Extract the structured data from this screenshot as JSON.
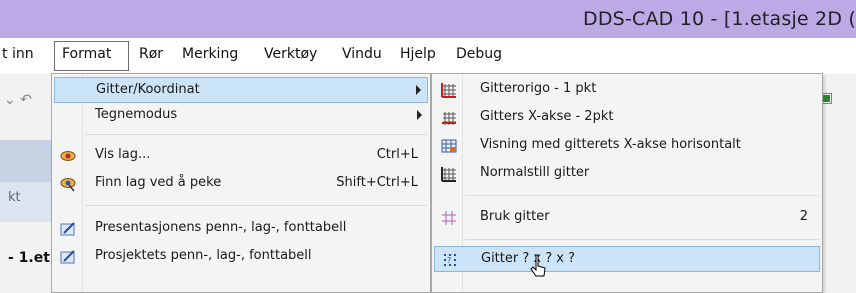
{
  "window": {
    "title": "DDS-CAD 10 - [1.etasje 2D ("
  },
  "menubar": {
    "items": [
      "t inn",
      "Format",
      "Rør",
      "Merking",
      "Verktøy",
      "Vindu",
      "Hjelp",
      "Debug"
    ],
    "active": "Format"
  },
  "background": {
    "tree_label_1": "kt",
    "tree_label_2": "- 1.et"
  },
  "format_menu": {
    "items": [
      {
        "label": "Gitter/Koordinat",
        "shortcut": "",
        "submenu": true,
        "highlighted": true,
        "icon": "none"
      },
      {
        "label": "Tegnemodus",
        "shortcut": "",
        "submenu": true,
        "icon": "none"
      },
      {
        "label": "Vis lag...",
        "shortcut": "Ctrl+L",
        "icon": "eye-icon"
      },
      {
        "label": "Finn lag ved å peke",
        "shortcut": "Shift+Ctrl+L",
        "icon": "eye-pointer-icon"
      },
      {
        "label": "Presentasjonens penn-, lag-, fonttabell",
        "shortcut": "",
        "icon": "pen-table-icon"
      },
      {
        "label": "Prosjektets penn-, lag-, fonttabell",
        "shortcut": "",
        "icon": "pen-table-icon"
      }
    ]
  },
  "grid_submenu": {
    "items": [
      {
        "label": "Gitterorigo - 1 pkt",
        "shortcut": "",
        "icon": "grid-origin-icon"
      },
      {
        "label": "Gitters X-akse - 2pkt",
        "shortcut": "",
        "icon": "grid-axis-icon"
      },
      {
        "label": "Visning med gitterets X-akse horisontalt",
        "shortcut": "",
        "icon": "grid-view-icon"
      },
      {
        "label": "Normalstill gitter",
        "shortcut": "",
        "icon": "grid-normal-icon"
      },
      {
        "label": "Bruk gitter",
        "shortcut": "2",
        "icon": "grid-use-icon"
      },
      {
        "label": "Gitter ? x ? x ?",
        "shortcut": "",
        "icon": "grid-size-icon",
        "highlighted": true
      }
    ]
  },
  "colors": {
    "titlebar": "#bcaae6",
    "highlight": "#cce4f7",
    "highlight_border": "#8cb8e0"
  }
}
